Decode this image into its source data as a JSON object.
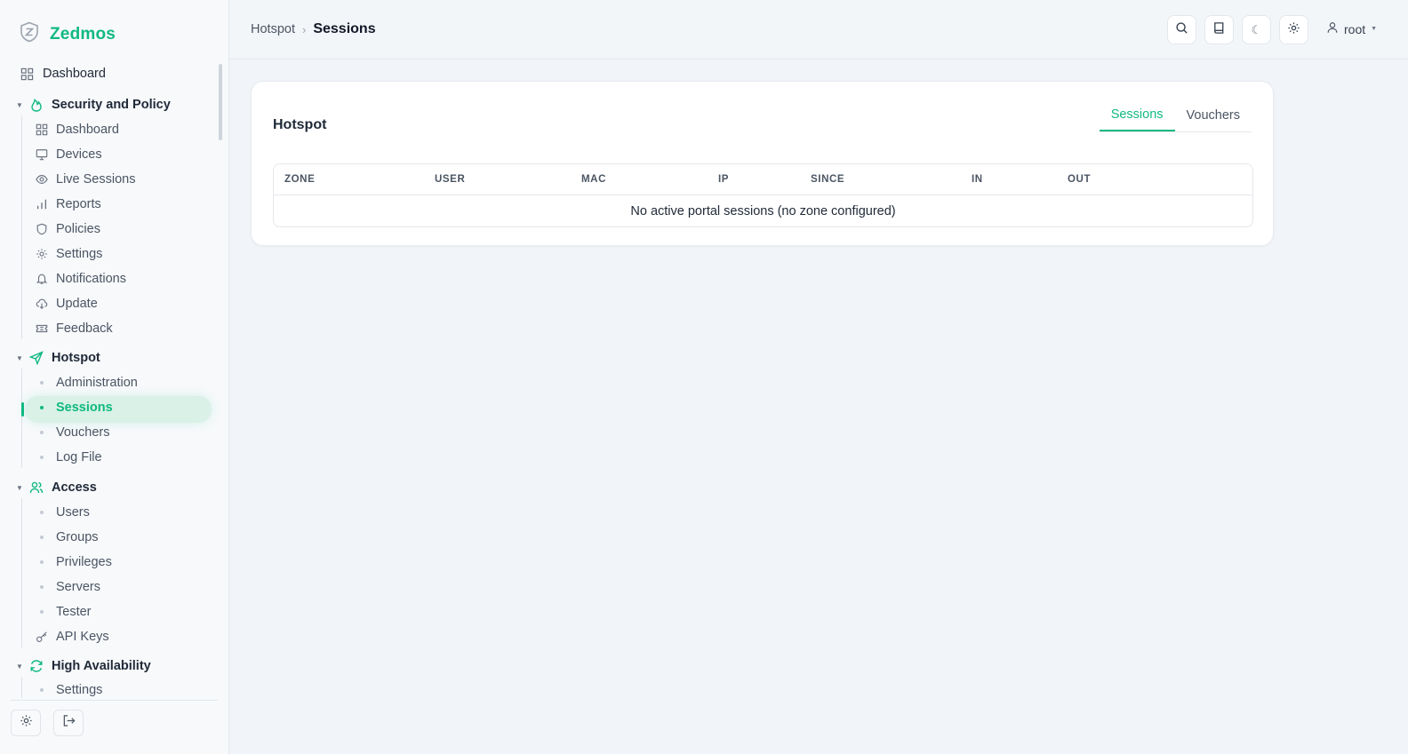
{
  "brand": {
    "name": "Zedmos",
    "icon": "shield-logo-icon"
  },
  "sidebar": {
    "top_item": {
      "label": "Dashboard",
      "icon": "grid-icon"
    },
    "groups": [
      {
        "label": "Security and Policy",
        "icon": "flame-icon",
        "items": [
          {
            "label": "Dashboard",
            "icon": "grid-icon"
          },
          {
            "label": "Devices",
            "icon": "monitor-icon"
          },
          {
            "label": "Live Sessions",
            "icon": "eye-icon"
          },
          {
            "label": "Reports",
            "icon": "bar-chart-icon"
          },
          {
            "label": "Policies",
            "icon": "shield-icon"
          },
          {
            "label": "Settings",
            "icon": "gear-icon"
          },
          {
            "label": "Notifications",
            "icon": "bell-icon"
          },
          {
            "label": "Update",
            "icon": "cloud-download-icon"
          },
          {
            "label": "Feedback",
            "icon": "ticket-icon"
          }
        ]
      },
      {
        "label": "Hotspot",
        "icon": "send-icon",
        "items": [
          {
            "label": "Administration"
          },
          {
            "label": "Sessions",
            "active": true
          },
          {
            "label": "Vouchers"
          },
          {
            "label": "Log File"
          }
        ]
      },
      {
        "label": "Access",
        "icon": "users-icon",
        "items": [
          {
            "label": "Users"
          },
          {
            "label": "Groups"
          },
          {
            "label": "Privileges"
          },
          {
            "label": "Servers"
          },
          {
            "label": "Tester"
          },
          {
            "label": "API Keys",
            "icon": "key-icon"
          }
        ]
      },
      {
        "label": "High Availability",
        "icon": "refresh-icon",
        "items": [
          {
            "label": "Settings"
          }
        ]
      }
    ]
  },
  "header": {
    "breadcrumb": {
      "parent": "Hotspot",
      "current": "Sessions"
    },
    "user": "root"
  },
  "card": {
    "title": "Hotspot",
    "tabs": [
      {
        "label": "Sessions",
        "active": true
      },
      {
        "label": "Vouchers",
        "active": false
      }
    ],
    "columns": [
      "ZONE",
      "USER",
      "MAC",
      "IP",
      "SINCE",
      "IN",
      "OUT"
    ],
    "empty_message": "No active portal sessions (no zone configured)"
  },
  "colors": {
    "accent": "#10b981",
    "background": "#f1f4f8"
  }
}
